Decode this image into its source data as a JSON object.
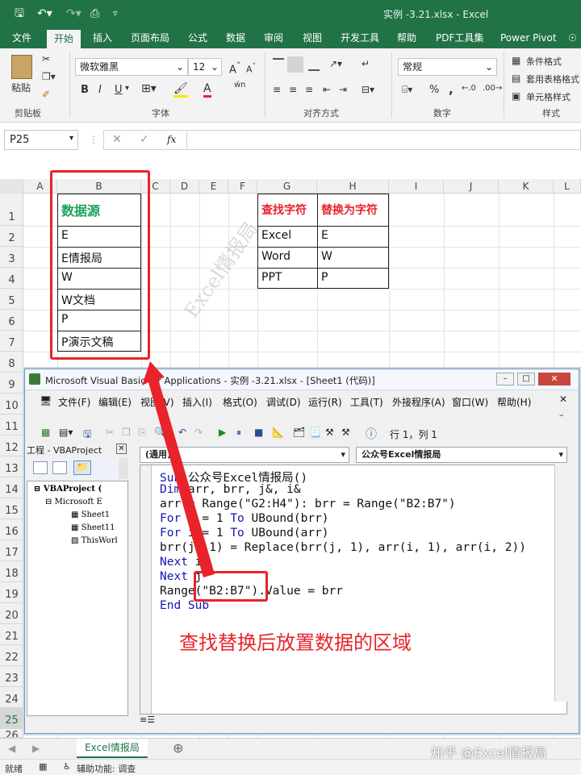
{
  "window": {
    "title": "实例 -3.21.xlsx  -  Excel"
  },
  "tabs": [
    "文件",
    "开始",
    "插入",
    "页面布局",
    "公式",
    "数据",
    "审阅",
    "视图",
    "开发工具",
    "帮助",
    "PDF工具集",
    "Power Pivot"
  ],
  "ribbon": {
    "paste_label": "粘贴",
    "font_name": "微软雅黑",
    "font_size": "12",
    "number_format": "常规",
    "styles": [
      "条件格式",
      "套用表格格式",
      "单元格样式"
    ],
    "groups": {
      "clipboard": "剪贴板",
      "font": "字体",
      "alignment": "对齐方式",
      "number": "数字",
      "styles": "样式"
    },
    "font_buttons": [
      "B",
      "I",
      "U"
    ],
    "grow_font": "A",
    "shrink_font": "A",
    "percent": "%",
    "comma": ","
  },
  "formula_bar": {
    "name_box": "P25",
    "fx": "fx",
    "value": ""
  },
  "sheet": {
    "columns": [
      "A",
      "B",
      "C",
      "D",
      "E",
      "F",
      "G",
      "H",
      "I",
      "J",
      "K",
      "L"
    ],
    "rows": [
      "1",
      "2",
      "3",
      "4",
      "5",
      "6",
      "7",
      "8",
      "9",
      "10",
      "11",
      "12",
      "13",
      "14",
      "15",
      "16",
      "17",
      "18",
      "19",
      "20",
      "21",
      "22",
      "23",
      "24",
      "25",
      "26"
    ],
    "source_header": "数据源",
    "source_values": [
      "E",
      "E情报局",
      "W",
      "W文档",
      "P",
      "P演示文稿"
    ],
    "lookup_headers": [
      "查找字符",
      "替换为字符"
    ],
    "lookup_rows": [
      [
        "Excel",
        "E"
      ],
      [
        "Word",
        "W"
      ],
      [
        "PPT",
        "P"
      ]
    ],
    "watermark": "Excel情报局",
    "colors": {
      "green": "#1aa25a",
      "red": "#e8232a"
    }
  },
  "vba": {
    "title": "Microsoft Visual Basic for Applications - 实例 -3.21.xlsx - [Sheet1 (代码)]",
    "menus": [
      "文件(F)",
      "编辑(E)",
      "视图(V)",
      "插入(I)",
      "格式(O)",
      "调试(D)",
      "运行(R)",
      "工具(T)",
      "外接程序(A)",
      "窗口(W)",
      "帮助(H)"
    ],
    "position": "行 1，列 1",
    "project_pane_title": "工程 - VBAProject",
    "project_tree": [
      "VBAProject (",
      "Microsoft E",
      "Sheet1",
      "Sheet11",
      "ThisWorl"
    ],
    "object_dropdown": "(通用)",
    "proc_dropdown": "公众号Excel情报局",
    "code": [
      "Sub 公众号Excel情报局()",
      "Dim arr, brr, j&, i&",
      "arr = Range(\"G2:H4\"): brr = Range(\"B2:B7\")",
      "For j = 1 To UBound(brr)",
      "For i = 1 To UBound(arr)",
      "brr(j, 1) = Replace(brr(j, 1), arr(i, 1), arr(i, 2))",
      "Next i",
      "Next j",
      "Range(\"B2:B7\").Value = brr",
      "End Sub"
    ]
  },
  "annotation": "查找替换后放置数据的区域",
  "sheet_tab": "Excel情报局",
  "status": {
    "ready": "就绪",
    "accessibility": "辅助功能: 调查"
  },
  "branding": "知乎 @Excel情报局"
}
